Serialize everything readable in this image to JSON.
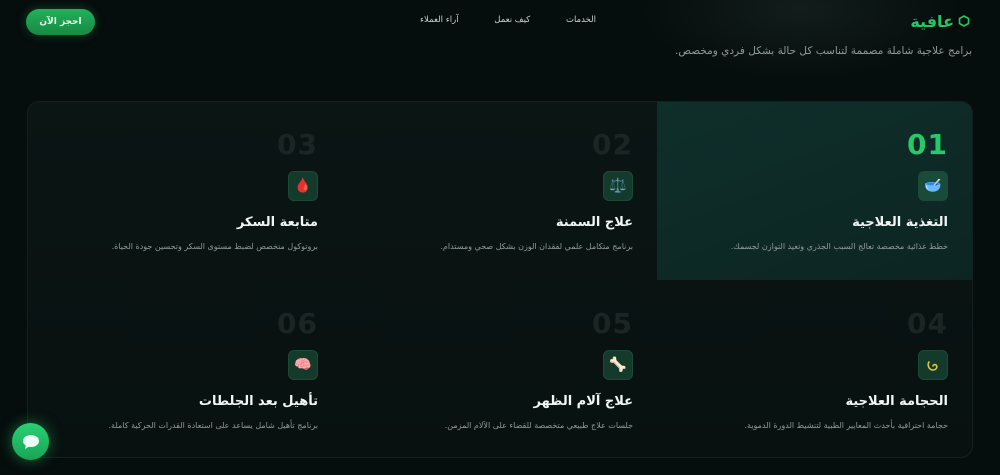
{
  "nav": {
    "cta": "احجز الآن",
    "links": [
      "الخدمات",
      "كيف نعمل",
      "آراء العملاء"
    ],
    "logo": "عافية"
  },
  "subtitle": "برامج علاجية شاملة مصممة لتناسب كل حالة بشكل فردي ومخصص.",
  "services": [
    {
      "num": "01",
      "icon": "bowl-icon",
      "glyph": "🥣",
      "title": "التغذية العلاجية",
      "desc": "خطط غذائية مخصصة تعالج السبب الجذري وتعيد التوازن لجسمك.",
      "active": true
    },
    {
      "num": "02",
      "icon": "scale-icon",
      "glyph": "⚖️",
      "title": "علاج السمنة",
      "desc": "برنامج متكامل علمي لفقدان الوزن بشكل صحي ومستدام.",
      "active": false
    },
    {
      "num": "03",
      "icon": "blood-drop-icon",
      "glyph": "🩸",
      "title": "متابعة السكر",
      "desc": "بروتوكول متخصص لضبط مستوى السكر وتحسين جودة الحياة.",
      "active": false
    },
    {
      "num": "04",
      "icon": "cupping-icon",
      "glyph": "🫙",
      "title": "الحجامة العلاجية",
      "desc": "حجامة احترافية بأحدث المعايير الطبية لتنشيط الدورة الدموية.",
      "active": false
    },
    {
      "num": "05",
      "icon": "bone-icon",
      "glyph": "🦴",
      "title": "علاج آلام الظهر",
      "desc": "جلسات علاج طبيعي متخصصة للقضاء على الآلام المزمن.",
      "active": false
    },
    {
      "num": "06",
      "icon": "brain-icon",
      "glyph": "🧠",
      "title": "تأهيل بعد الجلطات",
      "desc": "برنامج تأهيل شامل يساعد على استعادة القدرات الحركية كاملة.",
      "active": false
    }
  ]
}
